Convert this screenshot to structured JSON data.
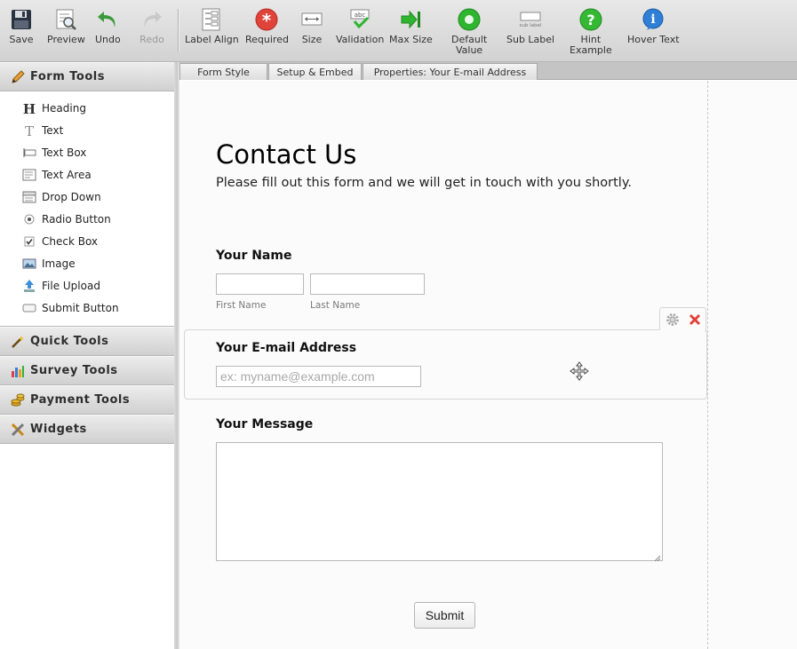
{
  "toolbar": {
    "save": "Save",
    "preview": "Preview",
    "undo": "Undo",
    "redo": "Redo",
    "label_align": "Label Align",
    "required": "Required",
    "size": "Size",
    "validation": "Validation",
    "max_size": "Max Size",
    "default_value_line1": "Default",
    "default_value_line2": "Value",
    "sub_label": "Sub Label",
    "hint_example_line1": "Hint",
    "hint_example_line2": "Example",
    "hover_text": "Hover Text",
    "validation_icon_text": "abc",
    "sub_label_icon_text": "sub label"
  },
  "sidebar": {
    "form_tools": "Form Tools",
    "tools": [
      {
        "label": "Heading",
        "icon": "heading-icon"
      },
      {
        "label": "Text",
        "icon": "text-icon"
      },
      {
        "label": "Text Box",
        "icon": "textbox-icon"
      },
      {
        "label": "Text Area",
        "icon": "textarea-icon"
      },
      {
        "label": "Drop Down",
        "icon": "dropdown-icon"
      },
      {
        "label": "Radio Button",
        "icon": "radio-icon"
      },
      {
        "label": "Check Box",
        "icon": "checkbox-icon"
      },
      {
        "label": "Image",
        "icon": "image-icon"
      },
      {
        "label": "File Upload",
        "icon": "upload-icon"
      },
      {
        "label": "Submit Button",
        "icon": "submit-icon"
      }
    ],
    "quick_tools": "Quick Tools",
    "survey_tools": "Survey Tools",
    "payment_tools": "Payment Tools",
    "widgets": "Widgets"
  },
  "tabs": {
    "form_style": "Form Style",
    "setup_embed": "Setup & Embed",
    "properties": "Properties: Your E-mail Address"
  },
  "form": {
    "title": "Contact Us",
    "subtitle": "Please fill out this form and we will get in touch with you shortly.",
    "name_label": "Your Name",
    "first_name_sublabel": "First Name",
    "last_name_sublabel": "Last Name",
    "email_label": "Your E-mail Address",
    "email_placeholder": "ex: myname@example.com",
    "message_label": "Your Message",
    "submit": "Submit"
  },
  "colors": {
    "required_red": "#e0433a",
    "green_accent": "#2fb52f",
    "hint_green": "#35b934",
    "hover_blue": "#2f7fd6",
    "undo_green": "#3a9a3a"
  }
}
